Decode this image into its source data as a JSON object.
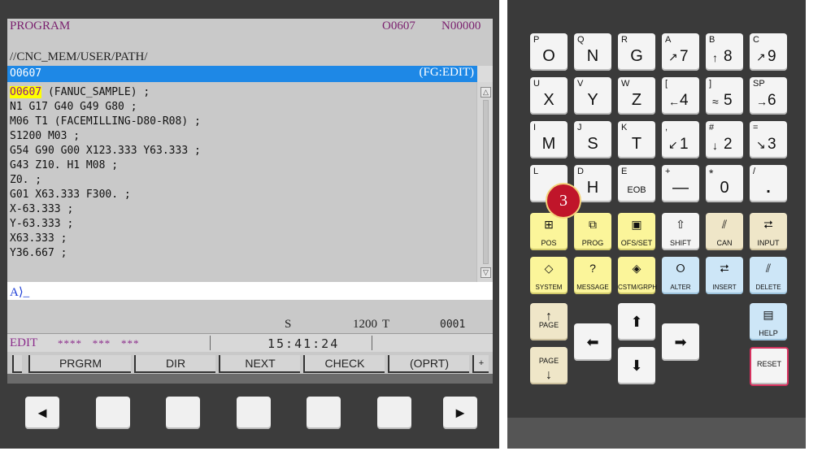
{
  "screen": {
    "title": "PROGRAM",
    "program_number": "O0607",
    "sequence_number": "N00000",
    "path": "//CNC_MEM/USER/PATH/",
    "selected_program": "O0607",
    "edit_mode_tag": "(FG:EDIT)",
    "code_first_prog": "O0607",
    "code_first_rest": " (FANUC_SAMPLE) ;",
    "code_lines": [
      "N1 G17 G40 G49 G80 ;",
      "M06 T1 (FACEMILLING-D80-R08) ;",
      "S1200 M03 ;",
      "G54 G90 G00 X123.333 Y63.333 ;",
      "G43 Z10. H1 M08 ;",
      "Z0. ;",
      "G01 X63.333 F300. ;",
      "X-63.333 ;",
      "Y-63.333 ;",
      "X63.333 ;",
      "Y36.667 ;"
    ],
    "input_prompt": "A⟩_",
    "spindle_label": "S",
    "spindle_value": "1200",
    "tool_label": "T",
    "tool_value": "0001",
    "mode": "EDIT",
    "status_stars": "****   ***   ***",
    "clock": "15:41:24",
    "soft_keys": [
      "PRGRM",
      "DIR",
      "NEXT",
      "CHECK",
      "(OPRT)"
    ],
    "soft_key_plus": "+",
    "hw_left_arrow": "◄",
    "hw_right_arrow": "►"
  },
  "keypad": {
    "row1": [
      {
        "addr": "P",
        "main": "O"
      },
      {
        "addr": "Q",
        "main": "N"
      },
      {
        "addr": "R",
        "main": "G"
      },
      {
        "addr": "A",
        "arrow": "↗",
        "num": "7"
      },
      {
        "addr": "B",
        "arrow": "↑",
        "num": "8"
      },
      {
        "addr": "C",
        "arrow": "↗",
        "num": "9"
      }
    ],
    "row2": [
      {
        "addr": "U",
        "main": "X"
      },
      {
        "addr": "V",
        "main": "Y"
      },
      {
        "addr": "W",
        "main": "Z"
      },
      {
        "addr": "[",
        "arrow": "←",
        "num": "4"
      },
      {
        "addr": "]",
        "arrow": "≈",
        "num": "5"
      },
      {
        "addr": "SP",
        "arrow": "→",
        "num": "6"
      }
    ],
    "row3": [
      {
        "addr": "I",
        "main": "M"
      },
      {
        "addr": "J",
        "main": "S"
      },
      {
        "addr": "K",
        "main": "T"
      },
      {
        "addr": ",",
        "arrow": "↙",
        "num": "1"
      },
      {
        "addr": "#",
        "arrow": "↓",
        "num": "2"
      },
      {
        "addr": "=",
        "arrow": "↘",
        "num": "3"
      }
    ],
    "row4": [
      {
        "addr": "L",
        "main": ""
      },
      {
        "addr": "D",
        "main": "H"
      },
      {
        "addr": "E",
        "main": "EOB"
      },
      {
        "addr": "+",
        "main": "—"
      },
      {
        "addr": "*",
        "main": "0"
      },
      {
        "addr": "/",
        "main": "."
      }
    ],
    "function_row1": [
      "POS",
      "PROG",
      "OFS/SET",
      "SHIFT",
      "CAN",
      "INPUT"
    ],
    "function_row2": [
      "SYSTEM",
      "MESSAGE",
      "CSTM/GRPH",
      "ALTER",
      "INSERT",
      "DELETE"
    ],
    "page_up": "PAGE",
    "page_down": "PAGE",
    "help": "HELP",
    "reset": "RESET",
    "badge_number": "3"
  }
}
